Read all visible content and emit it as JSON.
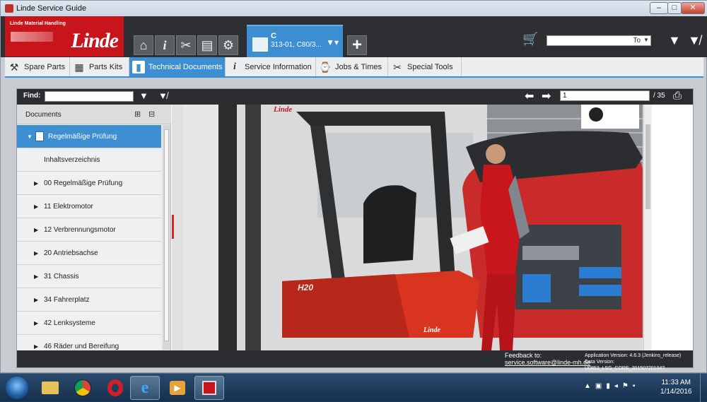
{
  "window": {
    "title": "Linde Service Guide",
    "minimize": "–",
    "maximize": "□",
    "close": "✕"
  },
  "brand": {
    "logo_text": "Linde",
    "subtitle": "Linde Material Handling"
  },
  "header": {
    "tool_icons": [
      "home-icon",
      "info-icon",
      "tools-icon",
      "forklift-icon",
      "gear-icon"
    ],
    "model": {
      "line1": "C",
      "line2": "313-01, C80/3..."
    },
    "search_value": "To"
  },
  "tabs": [
    {
      "label": "Spare Parts",
      "icon": "spare-parts-icon",
      "active": false
    },
    {
      "label": "Parts Kits",
      "icon": "parts-kits-icon",
      "active": false
    },
    {
      "label": "Technical Documents",
      "icon": "document-icon",
      "active": true
    },
    {
      "label": "Service Information",
      "icon": "info-icon",
      "active": false
    },
    {
      "label": "Jobs & Times",
      "icon": "jobs-icon",
      "active": false
    },
    {
      "label": "Special Tools",
      "icon": "tools-icon",
      "active": false
    }
  ],
  "findbar": {
    "label": "Find:",
    "page_value": "1",
    "page_total": "/ 35"
  },
  "documents": {
    "header": "Documents",
    "items": [
      {
        "label": "Regelmäßige Prüfung",
        "level": 0,
        "expanded": true,
        "selected": true
      },
      {
        "label": "Inhaltsverzeichnis",
        "level": 1
      },
      {
        "label": "00 Regelmäßige Prüfung",
        "level": 1
      },
      {
        "label": "11 Elektromotor",
        "level": 1
      },
      {
        "label": "12 Verbrennungsmotor",
        "level": 1
      },
      {
        "label": "20 Antriebsachse",
        "level": 1
      },
      {
        "label": "31 Chassis",
        "level": 1
      },
      {
        "label": "34 Fahrerplatz",
        "level": 1
      },
      {
        "label": "42 Lenksysteme",
        "level": 1
      },
      {
        "label": "46 Räder und Bereifung",
        "level": 1
      }
    ]
  },
  "image_text": {
    "mast_brand": "Linde",
    "model_badge": "H20",
    "body_brand": "Linde"
  },
  "footer": {
    "feedback_label": "Feedback to:",
    "feedback_email": "service.software@linde-mh.de",
    "app_version": "Application Version: 4.6.3 (Jenkins_release)",
    "data_version": "Data Version: U0853_LSG_CORE_20150720104?"
  },
  "taskbar": {
    "apps": [
      "windows-explorer-icon",
      "chrome-icon",
      "opera-icon",
      "internet-explorer-icon",
      "media-player-icon",
      "linde-app-icon"
    ],
    "time": "11:33 AM",
    "date": "1/14/2016"
  }
}
